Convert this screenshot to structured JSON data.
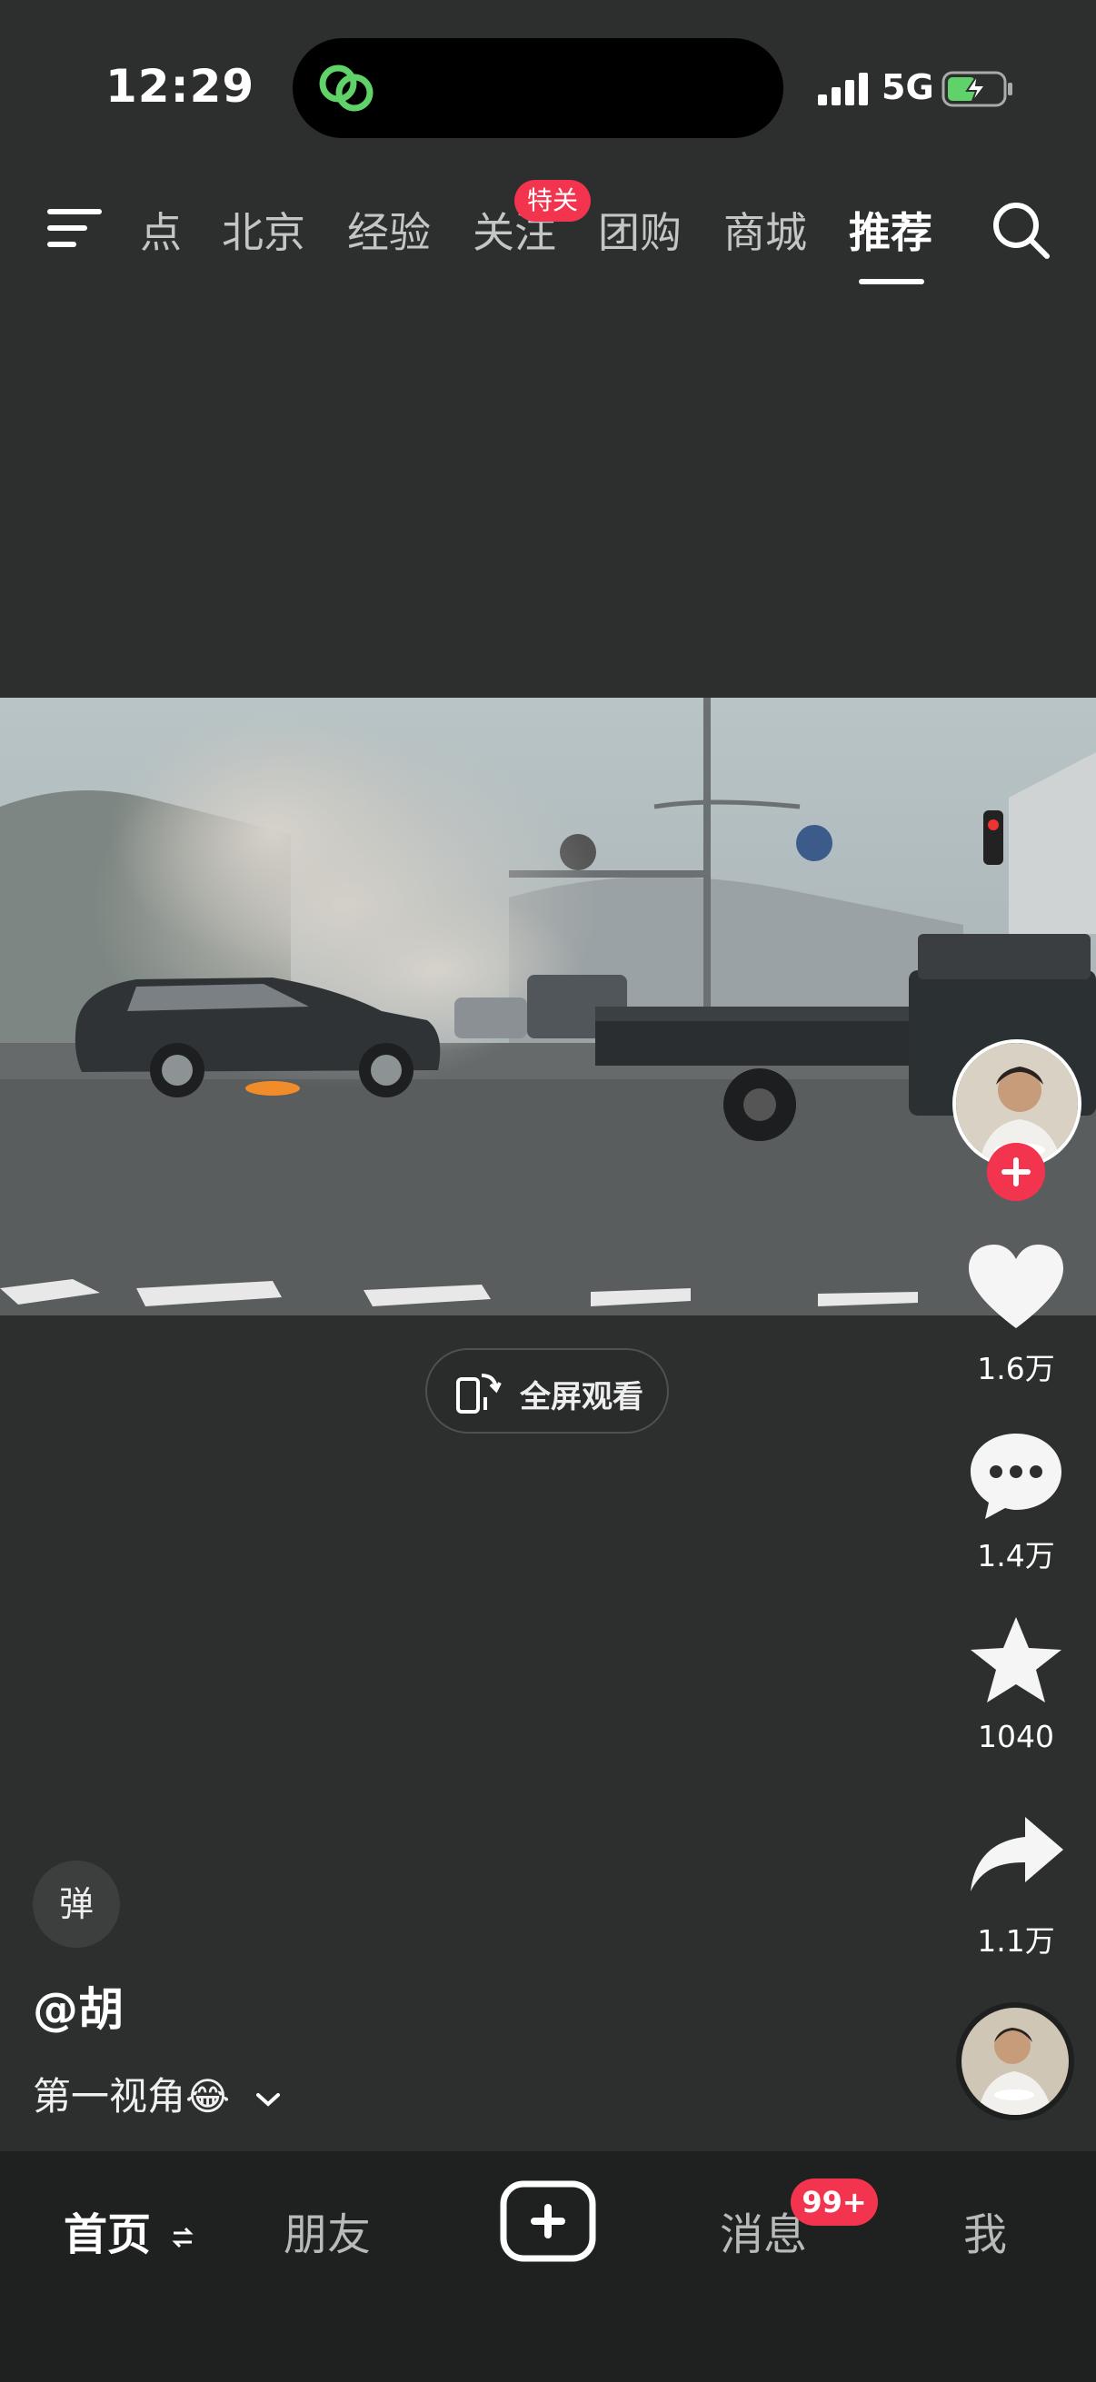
{
  "status_bar": {
    "time": "12:29",
    "network": "5G",
    "icons": [
      "app-logo-icon",
      "signal-icon",
      "battery-charging-icon"
    ]
  },
  "top_nav": {
    "tabs": [
      {
        "label": "点"
      },
      {
        "label": "北京"
      },
      {
        "label": "经验"
      },
      {
        "label": "关注",
        "badge": "特关"
      },
      {
        "label": "团购"
      },
      {
        "label": "商城"
      },
      {
        "label": "推荐",
        "active": true
      }
    ],
    "icons": [
      "menu-icon",
      "search-icon"
    ]
  },
  "video": {
    "fullscreen_label": "全屏观看"
  },
  "right_rail": {
    "like_count": "1.6万",
    "comment_count": "1.4万",
    "favorite_count": "1040",
    "share_count": "1.1万"
  },
  "post": {
    "danmu_label": "弹",
    "author": "@胡",
    "caption": "第一视角😂"
  },
  "bottom_nav": {
    "home": "首页",
    "friends": "朋友",
    "messages": "消息",
    "messages_badge": "99+",
    "me": "我"
  },
  "colors": {
    "background": "#2d2f2f",
    "accent": "#f2344e",
    "bottom_bar": "#1f2020"
  }
}
